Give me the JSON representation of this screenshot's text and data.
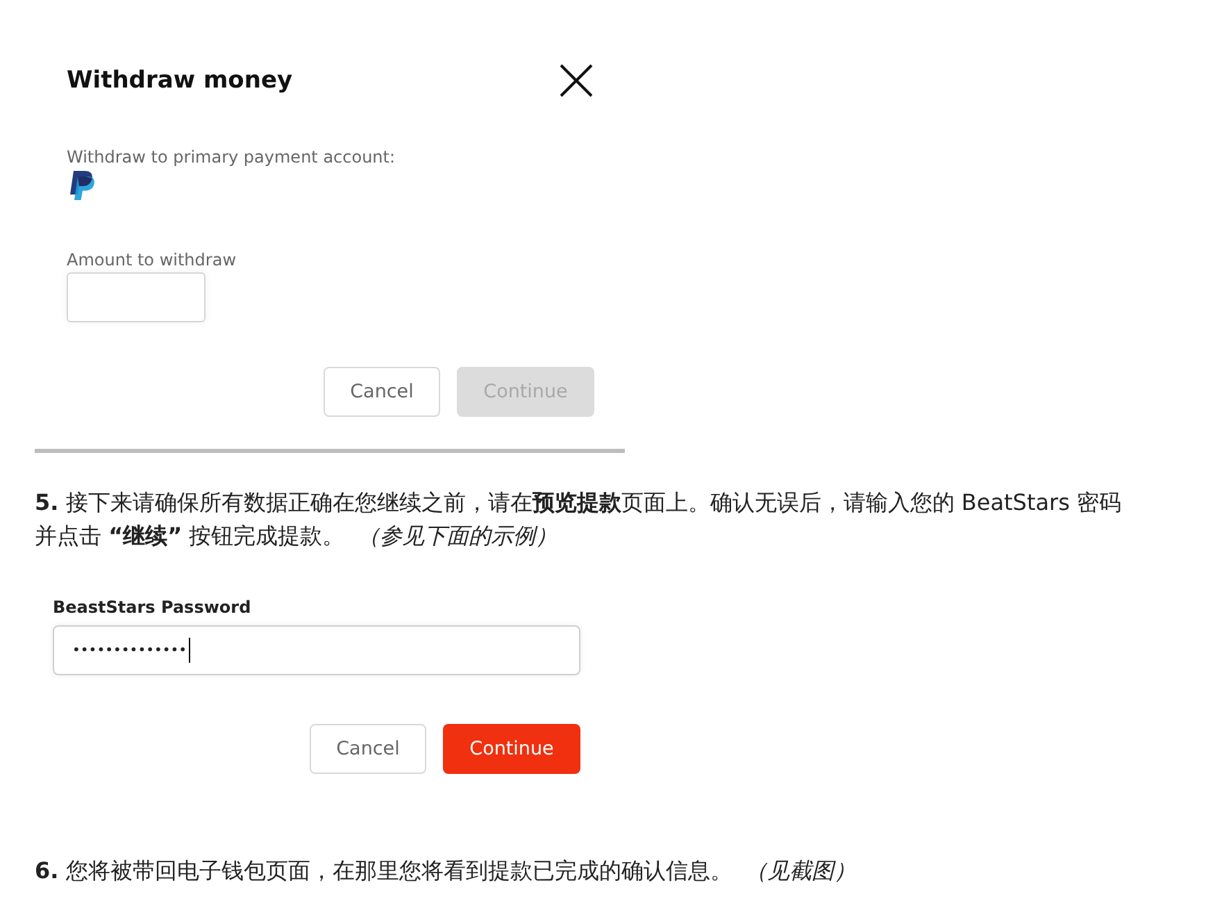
{
  "dialog": {
    "title": "Withdraw money",
    "account_label": "Withdraw to primary payment account:",
    "amount_field": {
      "label": "Amount to withdraw"
    },
    "buttons": [
      {
        "label": "Cancel",
        "kind": "secondary",
        "disabled": false
      },
      {
        "label": "Continue",
        "kind": "primary",
        "disabled": true
      }
    ]
  },
  "step_five": {
    "text": "**5.** 接下来请确保所有数据正确在您继续之前，请在**预览提款**页面上。确认无误后，请输入您的 BeatStars 密码并点击 **“继续”** 按钮完成提款。 *（参见下面的示例）*"
  },
  "password_form": {
    "label": "BeastStars Password",
    "value": "••••••••••••••",
    "focused": true,
    "buttons": [
      {
        "label": "Cancel",
        "kind": "secondary",
        "disabled": false
      },
      {
        "label": "Continue",
        "kind": "primary",
        "disabled": false
      }
    ]
  },
  "step_six": {
    "text": "**6.** 您将被带回电子钱包页面，在那里您将看到提款已完成的确认信息。 *（见截图）*"
  }
}
